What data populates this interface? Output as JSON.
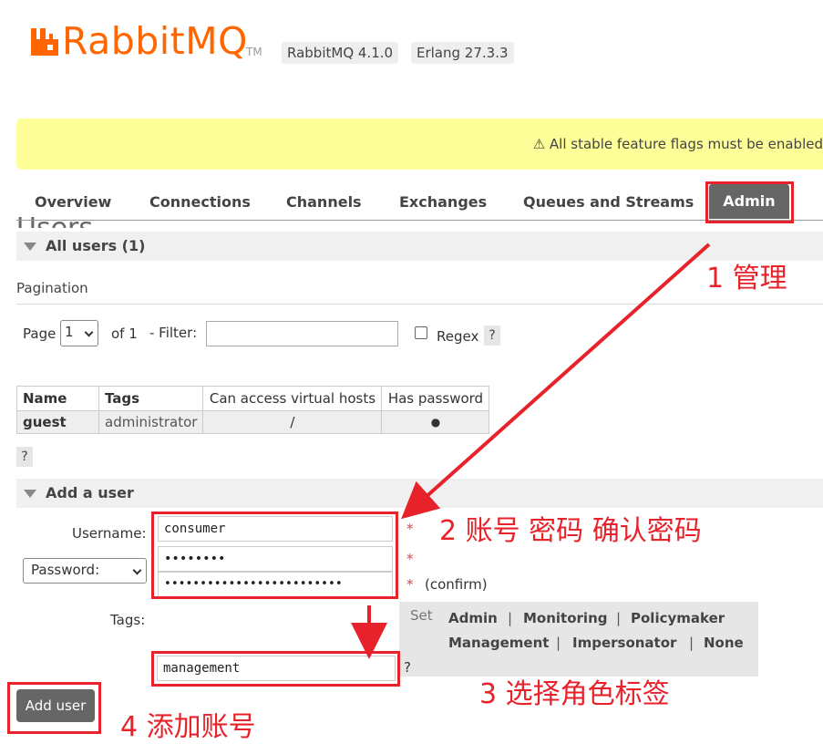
{
  "header": {
    "logo_text": "RabbitMQ",
    "logo_tm": "TM",
    "version_rabbitmq": "RabbitMQ 4.1.0",
    "version_erlang": "Erlang 27.3.3",
    "brand_color": "#ff6600"
  },
  "banner": {
    "text": "⚠ All stable feature flags must be enabled"
  },
  "tabs": {
    "overview": "Overview",
    "connections": "Connections",
    "channels": "Channels",
    "exchanges": "Exchanges",
    "queues": "Queues and Streams",
    "admin": "Admin"
  },
  "page_title": "Users",
  "all_users": {
    "heading": "All users (1)",
    "pagination_label": "Pagination",
    "page_label": "Page",
    "page_value": "1",
    "of_label": "of 1",
    "filter_label": "- Filter:",
    "regex_label": "Regex",
    "help": "?",
    "table": {
      "headers": [
        "Name",
        "Tags",
        "Can access virtual hosts",
        "Has password"
      ],
      "rows": [
        {
          "name": "guest",
          "tags": "administrator",
          "vhosts": "/",
          "has_password": "●"
        }
      ]
    }
  },
  "add_user": {
    "heading": "Add a user",
    "username_label": "Username:",
    "username_value": "consumer",
    "password_mode": "Password:",
    "password_value": "••••••••",
    "confirm_value": "•••••••••••••••••••••••••",
    "star": "*",
    "confirm_label": "(confirm)",
    "tags_label": "Tags:",
    "tags_value": "management",
    "set_label": "Set",
    "tag_options": [
      "Admin",
      "Monitoring",
      "Policymaker",
      "Management",
      "Impersonator",
      "None"
    ],
    "separator": "|",
    "submit_label": "Add user"
  },
  "annotations": {
    "step1": "1 管理",
    "step2": "2 账号 密码 确认密码",
    "step3": "3 选择角色标签",
    "step4": "4 添加账号",
    "color": "#e8222a"
  }
}
